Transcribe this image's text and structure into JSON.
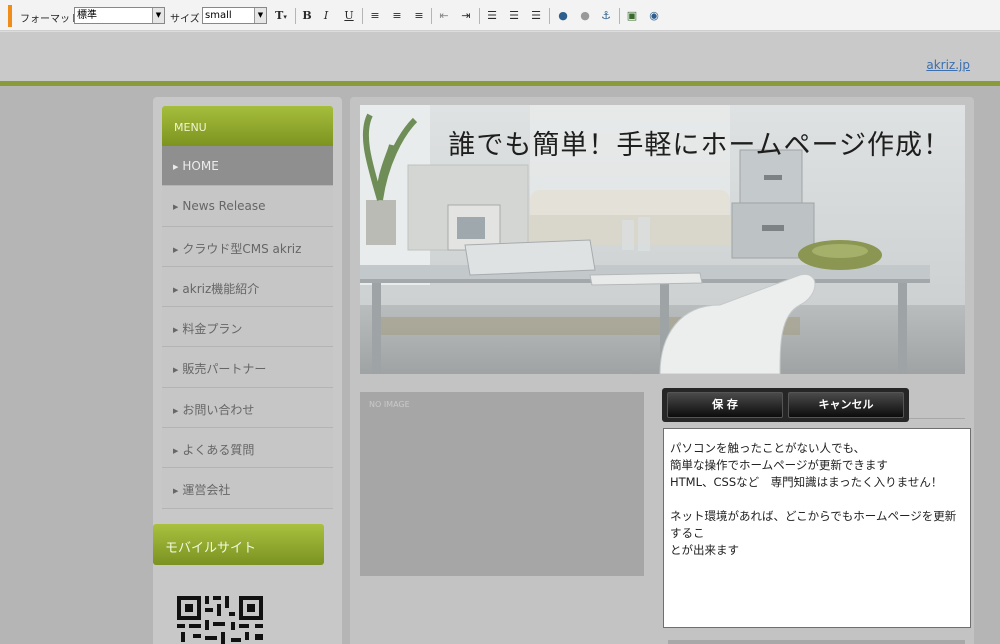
{
  "toolbar": {
    "format_label": "フォーマット",
    "format_value": "標準",
    "size_label": "サイズ",
    "size_value": "small",
    "text_color_icon": "text-color-icon",
    "bold_label": "B",
    "italic_label": "I",
    "underline_label": "U"
  },
  "header": {
    "site_link": "akriz.jp"
  },
  "sidebar": {
    "menu_title": "MENU",
    "items": [
      {
        "label": "HOME",
        "active": true
      },
      {
        "label": "News Release"
      },
      {
        "label": "クラウド型CMS akriz"
      },
      {
        "label": "akriz機能紹介"
      },
      {
        "label": "料金プラン"
      },
      {
        "label": "販売パートナー"
      },
      {
        "label": "お問い合わせ"
      },
      {
        "label": "よくある質問"
      },
      {
        "label": "運営会社"
      }
    ],
    "mobile_title": "モバイルサイト"
  },
  "main": {
    "banner_title": "誰でも簡単！手軽にホームページ作成！",
    "noimage_label": "NO IMAGE",
    "save_label": "保 存",
    "cancel_label": "キャンセル",
    "editor_lines": [
      "パソコンを触ったことがない人でも、",
      "簡単な操作でホームページが更新できます",
      "HTML、CSSなど　専門知識はまったく入りません！",
      "",
      "ネット環境があれば、どこからでもホームページを更新するこ",
      "とが出来ます"
    ]
  },
  "colors": {
    "accent_green": "#8a9c39",
    "toolbar_grip": "#f08c1a",
    "link": "#3b6fb0"
  }
}
